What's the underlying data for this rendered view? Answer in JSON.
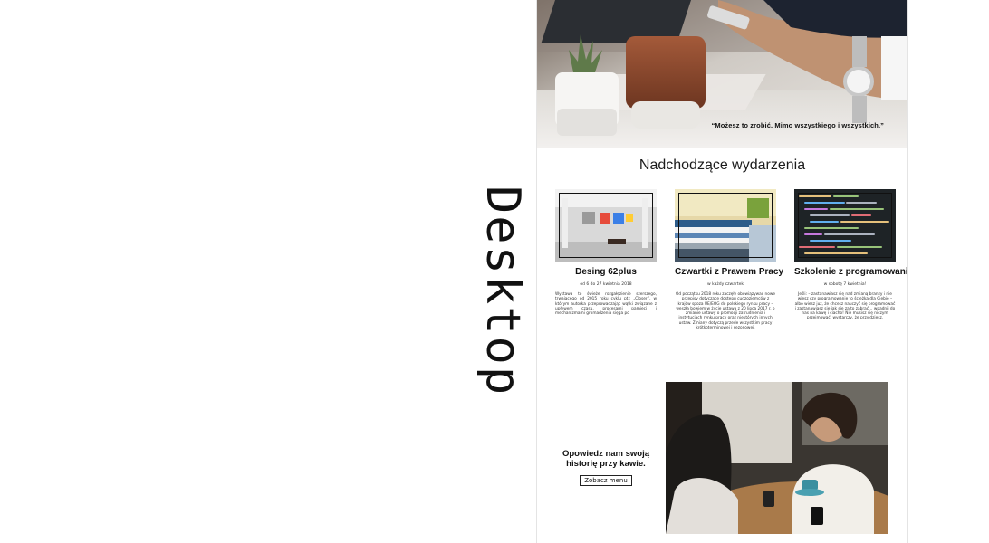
{
  "side_label": "Desktop",
  "hero": {
    "quote": "“Możesz to zrobić. Mimo wszystkiego i wszystkich.”"
  },
  "events": {
    "title": "Nadchodzące wydarzenia",
    "items": [
      {
        "title": "Desing 62plus",
        "meta": "od 6 do 27 kwietnia 2018",
        "desc": "Wystawa to świeże rozgałęzienie szerszego, trwającego od 2015 roku cyklu pt.: „Closer”, w którym autorka przeprowadzając wątki związane z upływem czasu, procesami pamięci i mechanizmami gromadzenia sięga po"
      },
      {
        "title": "Czwartki z Prawem Pracy",
        "meta": "w każdy czwartek",
        "desc": "Od początku 2018 roku zaczęły obowiązywać nowe przepisy dotyczące dostępu cudzoziemców z krajów spoza UE/EOG do polskiego rynku pracy – weszła bowiem w życie ustawa z 20 lipca 2017 r. o zmianie ustawy o promocji zatrudnienia i instytucjach rynku pracy oraz niektórych innych ustaw. Zmiany dotyczą przede wszystkim pracy krótkoterminowej i sezonowej."
      },
      {
        "title": "Szkolenie z programowania",
        "meta": "w sobotę 7 kwietnia!",
        "desc": "Jeśli: – zastanawiasz się nad zmianą branży i nie wiesz czy programowanie to ścieżka dla Ciebie – albo wiesz już, że chcesz nauczyć się programować i zastanawiasz się jak się za to zabrać… wpadnij do nas na kawę i ciacho! Nie musisz się niczym przejmować, wystarczy, że przyjdziesz."
      }
    ]
  },
  "promo": {
    "title": "Opowiedz nam swoją historię przy kawie.",
    "button_label": "Zobacz menu"
  }
}
